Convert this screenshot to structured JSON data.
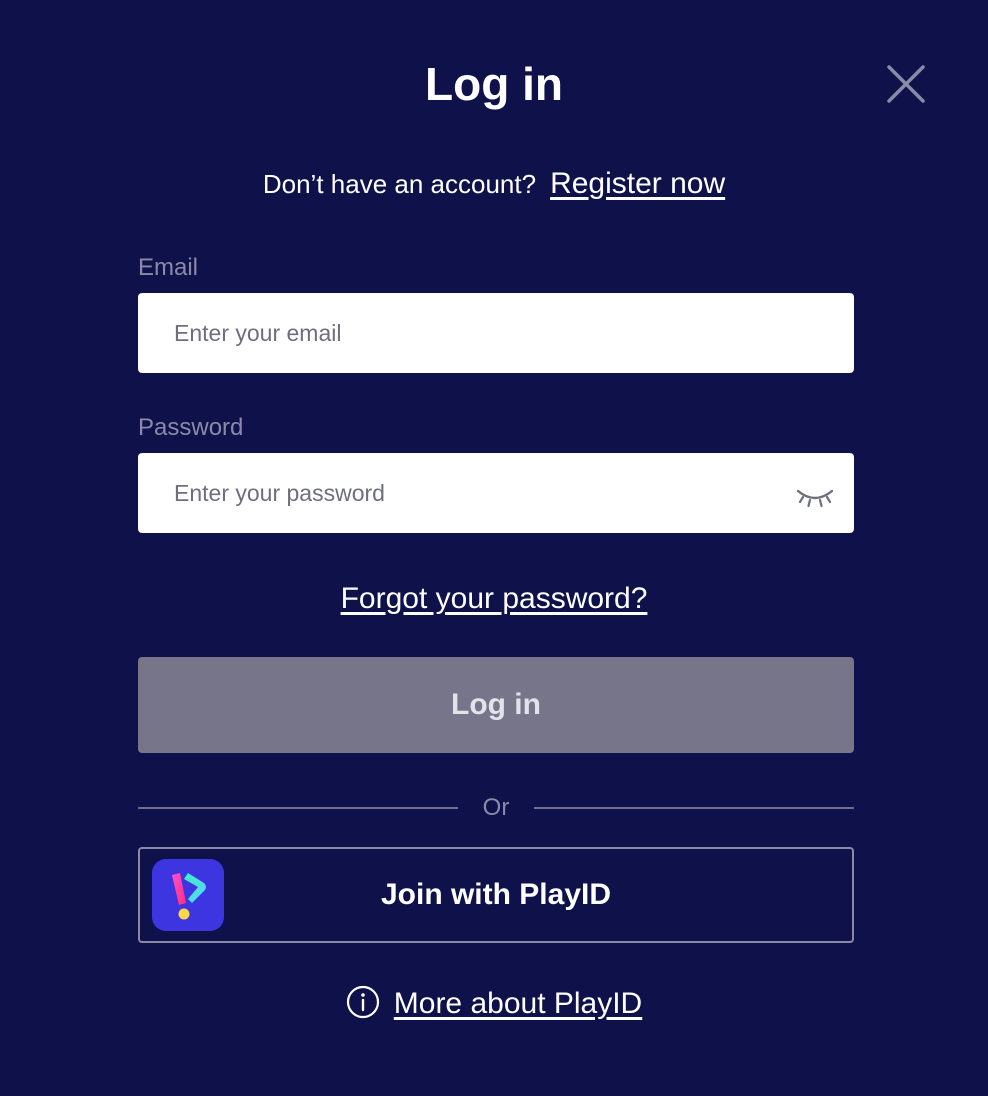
{
  "modal": {
    "title": "Log in"
  },
  "register": {
    "question": "Don’t have an account?",
    "link": "Register now"
  },
  "email": {
    "label": "Email",
    "placeholder": "Enter your email",
    "value": ""
  },
  "password": {
    "label": "Password",
    "placeholder": "Enter your password",
    "value": "",
    "toggle_icon": "eye-closed-icon"
  },
  "forgot": {
    "link": "Forgot your password?"
  },
  "login_button": {
    "label": "Log in"
  },
  "divider": {
    "text": "Or"
  },
  "playid": {
    "label": "Join with PlayID",
    "logo_icon": "playid-logo-icon"
  },
  "more": {
    "icon": "info-icon",
    "link": "More about PlayID"
  },
  "colors": {
    "background": "#0e114a",
    "login_button_disabled": "#77758a",
    "muted_text": "#8a8aa8"
  }
}
